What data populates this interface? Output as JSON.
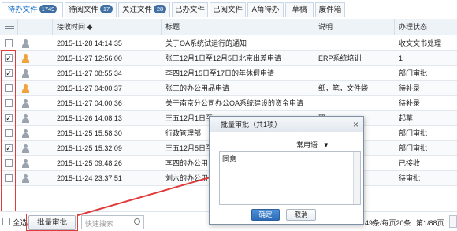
{
  "tabs": [
    {
      "label": "待办文件",
      "badge": "1749",
      "active": true
    },
    {
      "label": "待阅文件",
      "badge": "17"
    },
    {
      "label": "关注文件",
      "badge": "28"
    },
    {
      "label": "已办文件"
    },
    {
      "label": "已阅文件"
    },
    {
      "label": "A角待办"
    },
    {
      "label": "草稿"
    },
    {
      "label": "废件箱"
    }
  ],
  "columns": {
    "received": "接收时间 ◆",
    "title": "标题",
    "note": "说明",
    "status": "办理状态"
  },
  "rows": [
    {
      "checked": false,
      "icon": "gray",
      "time": "2015-11-28 14:14:35",
      "title": "关于OA系统试运行的通知",
      "note": "",
      "status": "收文文书处理"
    },
    {
      "checked": true,
      "icon": "orange",
      "time": "2015-11-27 12:56:00",
      "title": "张三12月1日至12月5日北京出差申请",
      "note": "ERP系统培训",
      "status": "1"
    },
    {
      "checked": true,
      "icon": "gray",
      "time": "2015-11-27 08:55:34",
      "title": "李四12月15日至17日的年休假申请",
      "note": "",
      "status": "部门审批"
    },
    {
      "checked": false,
      "icon": "orange",
      "time": "2015-11-27 04:00:37",
      "title": "张三的办公用品申请",
      "note": "纸，笔，文件袋",
      "status": "待补录"
    },
    {
      "checked": false,
      "icon": "gray",
      "time": "2015-11-27 04:00:36",
      "title": "关于南京分公司办公OA系统建设的资金申请",
      "note": "",
      "status": "待补录"
    },
    {
      "checked": true,
      "icon": "gray",
      "time": "2015-11-26 14:08:13",
      "title": "王五12月1日至",
      "note": "研",
      "status": "起草"
    },
    {
      "checked": false,
      "icon": "gray",
      "time": "2015-11-25 15:58:30",
      "title": "行政管理部",
      "note": "",
      "status": "部门审批"
    },
    {
      "checked": true,
      "icon": "gray",
      "time": "2015-11-25 15:32:09",
      "title": "王五12月5日至",
      "note": "",
      "status": "部门审批"
    },
    {
      "checked": false,
      "icon": "gray",
      "time": "2015-11-25 09:48:26",
      "title": "李四的办公用",
      "note": "",
      "status": "已接收"
    },
    {
      "checked": false,
      "icon": "gray",
      "time": "2015-11-24 23:37:51",
      "title": "刘六的办公用",
      "note": "",
      "status": "待审批"
    }
  ],
  "footer": {
    "select_all": "全选",
    "batch_approve": "批量审批",
    "search_placeholder": "快速搜索",
    "pagination": "49条/每页20条",
    "page": "第1/88页"
  },
  "dialog": {
    "title": "批量审批（共1项）",
    "common_phrase": "常用语",
    "comment": "同意",
    "confirm": "确定",
    "cancel": "取消"
  },
  "colors": {
    "accent": "#0b69c7",
    "annotation": "#e03a3a"
  }
}
